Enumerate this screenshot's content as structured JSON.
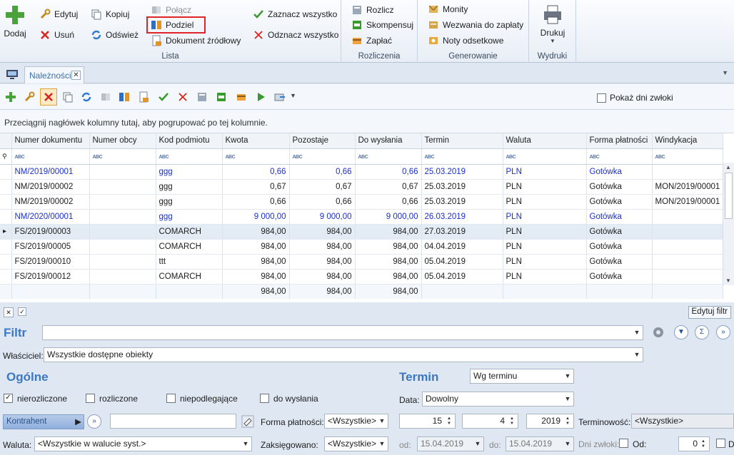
{
  "ribbon": {
    "add": "Dodaj",
    "edit": "Edytuj",
    "delete": "Usuń",
    "copy": "Kopiuj",
    "refresh": "Odśwież",
    "merge": "Połącz",
    "split": "Podziel",
    "source_doc": "Dokument źródłowy",
    "select_all": "Zaznacz wszystko",
    "deselect_all": "Odznacz wszystko",
    "group_list": "Lista",
    "settle": "Rozlicz",
    "compensate": "Skompensuj",
    "pay": "Zapłać",
    "group_settlements": "Rozliczenia",
    "reminders": "Monity",
    "payment_requests": "Wezwania do zapłaty",
    "interest_notes": "Noty odsetkowe",
    "group_generate": "Generowanie",
    "print": "Drukuj",
    "group_print": "Wydruki"
  },
  "tab": {
    "label": "Należności",
    "close": "✕"
  },
  "toolbar": {
    "show_days_late": "Pokaż dni zwłoki"
  },
  "grid": {
    "group_hint": "Przeciągnij nagłówek kolumny tutaj, aby pogrupować po tej kolumnie.",
    "columns": [
      "Numer dokumentu",
      "Numer obcy",
      "Kod podmiotu",
      "Kwota",
      "Pozostaje",
      "Do wysłania",
      "Termin",
      "Waluta",
      "Forma płatności",
      "Windykacja"
    ],
    "filter_abc": "ABC",
    "rows": [
      {
        "doc": "NM/2019/00001",
        "ext": "",
        "code": "ggg",
        "amount": "0,66",
        "left": "0,66",
        "tosend": "0,66",
        "due": "25.03.2019",
        "cur": "PLN",
        "pay": "Gotówka",
        "coll": "",
        "blue": true,
        "sel": false
      },
      {
        "doc": "NM/2019/00002",
        "ext": "",
        "code": "ggg",
        "amount": "0,67",
        "left": "0,67",
        "tosend": "0,67",
        "due": "25.03.2019",
        "cur": "PLN",
        "pay": "Gotówka",
        "coll": "MON/2019/00001",
        "blue": false,
        "sel": false
      },
      {
        "doc": "NM/2019/00002",
        "ext": "",
        "code": "ggg",
        "amount": "0,66",
        "left": "0,66",
        "tosend": "0,66",
        "due": "25.03.2019",
        "cur": "PLN",
        "pay": "Gotówka",
        "coll": "MON/2019/00001",
        "blue": false,
        "sel": false
      },
      {
        "doc": "NM/2020/00001",
        "ext": "",
        "code": "ggg",
        "amount": "9 000,00",
        "left": "9 000,00",
        "tosend": "9 000,00",
        "due": "26.03.2019",
        "cur": "PLN",
        "pay": "Gotówka",
        "coll": "",
        "blue": true,
        "sel": false
      },
      {
        "doc": "FS/2019/00003",
        "ext": "",
        "code": "COMARCH",
        "amount": "984,00",
        "left": "984,00",
        "tosend": "984,00",
        "due": "27.03.2019",
        "cur": "PLN",
        "pay": "Gotówka",
        "coll": "",
        "blue": false,
        "sel": true
      },
      {
        "doc": "FS/2019/00005",
        "ext": "",
        "code": "COMARCH",
        "amount": "984,00",
        "left": "984,00",
        "tosend": "984,00",
        "due": "04.04.2019",
        "cur": "PLN",
        "pay": "Gotówka",
        "coll": "",
        "blue": false,
        "sel": false
      },
      {
        "doc": "FS/2019/00010",
        "ext": "",
        "code": "ttt",
        "amount": "984,00",
        "left": "984,00",
        "tosend": "984,00",
        "due": "05.04.2019",
        "cur": "PLN",
        "pay": "Gotówka",
        "coll": "",
        "blue": false,
        "sel": false
      },
      {
        "doc": "FS/2019/00012",
        "ext": "",
        "code": "COMARCH",
        "amount": "984,00",
        "left": "984,00",
        "tosend": "984,00",
        "due": "05.04.2019",
        "cur": "PLN",
        "pay": "Gotówka",
        "coll": "",
        "blue": false,
        "sel": false
      }
    ],
    "summary": {
      "amount": "984,00",
      "left": "984,00",
      "tosend": "984,00"
    }
  },
  "status": {
    "edit_filter": "Edytuj filtr"
  },
  "filter": {
    "title": "Filtr",
    "owner_label": "Właściciel:",
    "owner_value": "Wszystkie dostępne obiekty",
    "general": "Ogólne",
    "unsettled": "nierozliczone",
    "settled": "rozliczone",
    "not_subject": "niepodlegające",
    "to_send": "do wysłania",
    "contractor": "Kontrahent",
    "pay_form_label": "Forma płatności:",
    "pay_form_value": "<Wszystkie>",
    "currency_label": "Waluta:",
    "currency_value": "<Wszystkie w walucie syst.>",
    "posted_label": "Zaksięgowano:",
    "posted_value": "<Wszystkie>",
    "term_title": "Termin",
    "term_mode": "Wg terminu",
    "date_label": "Data:",
    "date_value": "Dowolny",
    "day": "15",
    "month": "4",
    "year": "2019",
    "term_label": "Terminowość:",
    "term_value": "<Wszystkie>",
    "from_label": "od:",
    "from_value": "15.04.2019",
    "to_label": "do:",
    "to_value": "15.04.2019",
    "days_late_label": "Dni zwłoki:",
    "since_label": "Od:",
    "since_value": "0",
    "d_label": "D"
  }
}
